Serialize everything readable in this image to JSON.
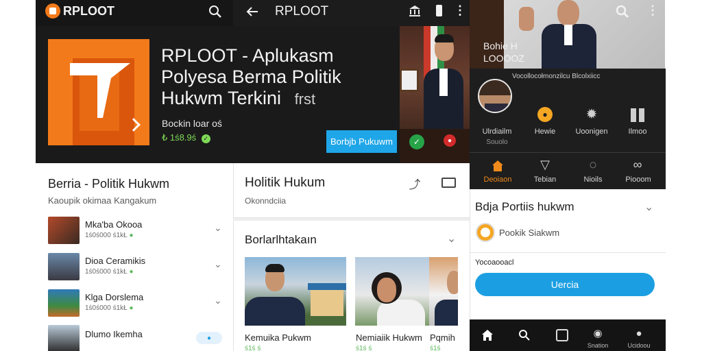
{
  "topbar": {
    "brand": "RPLOOT",
    "title": "RPLOOT"
  },
  "hero": {
    "title": "RPLOOT - Aplukasm Polyesa Berma Politik Hukwm Terkini",
    "title_suffix": "frst",
    "subtitle": "Bockin loar oś",
    "price": "₺ 1ś8.9ś",
    "button": "Borbjb Pukuwm"
  },
  "photo_top": {
    "caption": "Bohie H LOOOOZ"
  },
  "menu": {
    "header": "Vocollocołmonzilcu Blcolxiicc",
    "profile_name": "Ulrdiailm",
    "profile_meta": "Souolo",
    "row1": [
      "Hewie",
      "Uoonigen",
      "Ilmoo"
    ],
    "row2": [
      "Deoiaon",
      "Tebian",
      "Nioils",
      "Piooom"
    ]
  },
  "left_card": {
    "title": "Berria - Politik Hukwm",
    "subtitle": "Kaoupik okimaa Kangakum",
    "items": [
      {
        "title": "Mka'ba Okooa",
        "meta": "1ś0ś000 ś1kŁ"
      },
      {
        "title": "Dioa Ceramikis",
        "meta": "1ś0ś000 ś1kŁ"
      },
      {
        "title": "Klga Dorslema",
        "meta": "1ś0ś000 ś1kŁ"
      },
      {
        "title": "Dlumo Ikemha",
        "meta": ""
      }
    ]
  },
  "mid_card": {
    "title": "Holitik Hukum",
    "subtitle": "Okonndciia"
  },
  "mid2_card": {
    "title": "Borlarlhtakaın",
    "news": [
      {
        "title": "Kemuika Pukwm",
        "meta": "ś1ś ś"
      },
      {
        "title": "Nemiaiik Hukwm",
        "meta": "ś1ś ś"
      },
      {
        "title": "Pqmih",
        "meta": "ś1ś"
      }
    ]
  },
  "right_card": {
    "title": "Bdja Portiis hukwm",
    "item": "Pookik Siakwm",
    "section": "Yocoaooacl",
    "button": "Uercia"
  },
  "bottom_nav": {
    "labels": [
      "",
      "",
      "",
      "Snation",
      "Ucidoou"
    ]
  }
}
